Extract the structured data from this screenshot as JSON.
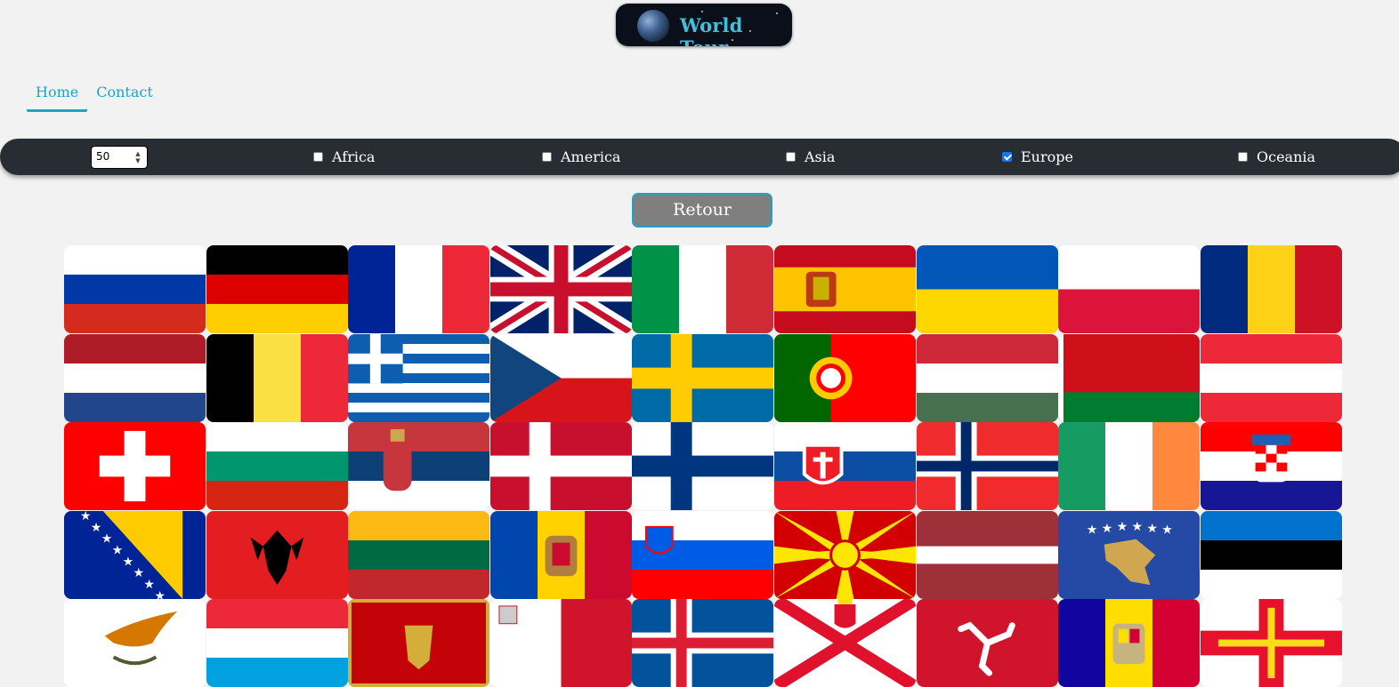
{
  "logo": {
    "text": "World Tour"
  },
  "nav": {
    "items": [
      {
        "label": "Home",
        "active": true
      },
      {
        "label": "Contact",
        "active": false
      }
    ]
  },
  "filters": {
    "count_value": "50",
    "continents": [
      {
        "label": "Africa",
        "checked": false
      },
      {
        "label": "America",
        "checked": false
      },
      {
        "label": "Asia",
        "checked": false
      },
      {
        "label": "Europe",
        "checked": true
      },
      {
        "label": "Oceania",
        "checked": false
      }
    ]
  },
  "retour_label": "Retour",
  "flags": [
    "russia",
    "germany",
    "france",
    "united-kingdom",
    "italy",
    "spain",
    "ukraine",
    "poland",
    "romania",
    "netherlands",
    "belgium",
    "greece",
    "czechia",
    "sweden",
    "portugal",
    "hungary",
    "belarus",
    "austria",
    "switzerland",
    "bulgaria",
    "serbia",
    "denmark",
    "finland",
    "slovakia",
    "norway",
    "ireland",
    "croatia",
    "bosnia-herzegovina",
    "albania",
    "lithuania",
    "moldova",
    "slovenia",
    "north-macedonia",
    "latvia",
    "kosovo",
    "estonia",
    "cyprus",
    "luxembourg",
    "montenegro",
    "malta",
    "iceland",
    "jersey",
    "isle-of-man",
    "andorra",
    "guernsey"
  ]
}
